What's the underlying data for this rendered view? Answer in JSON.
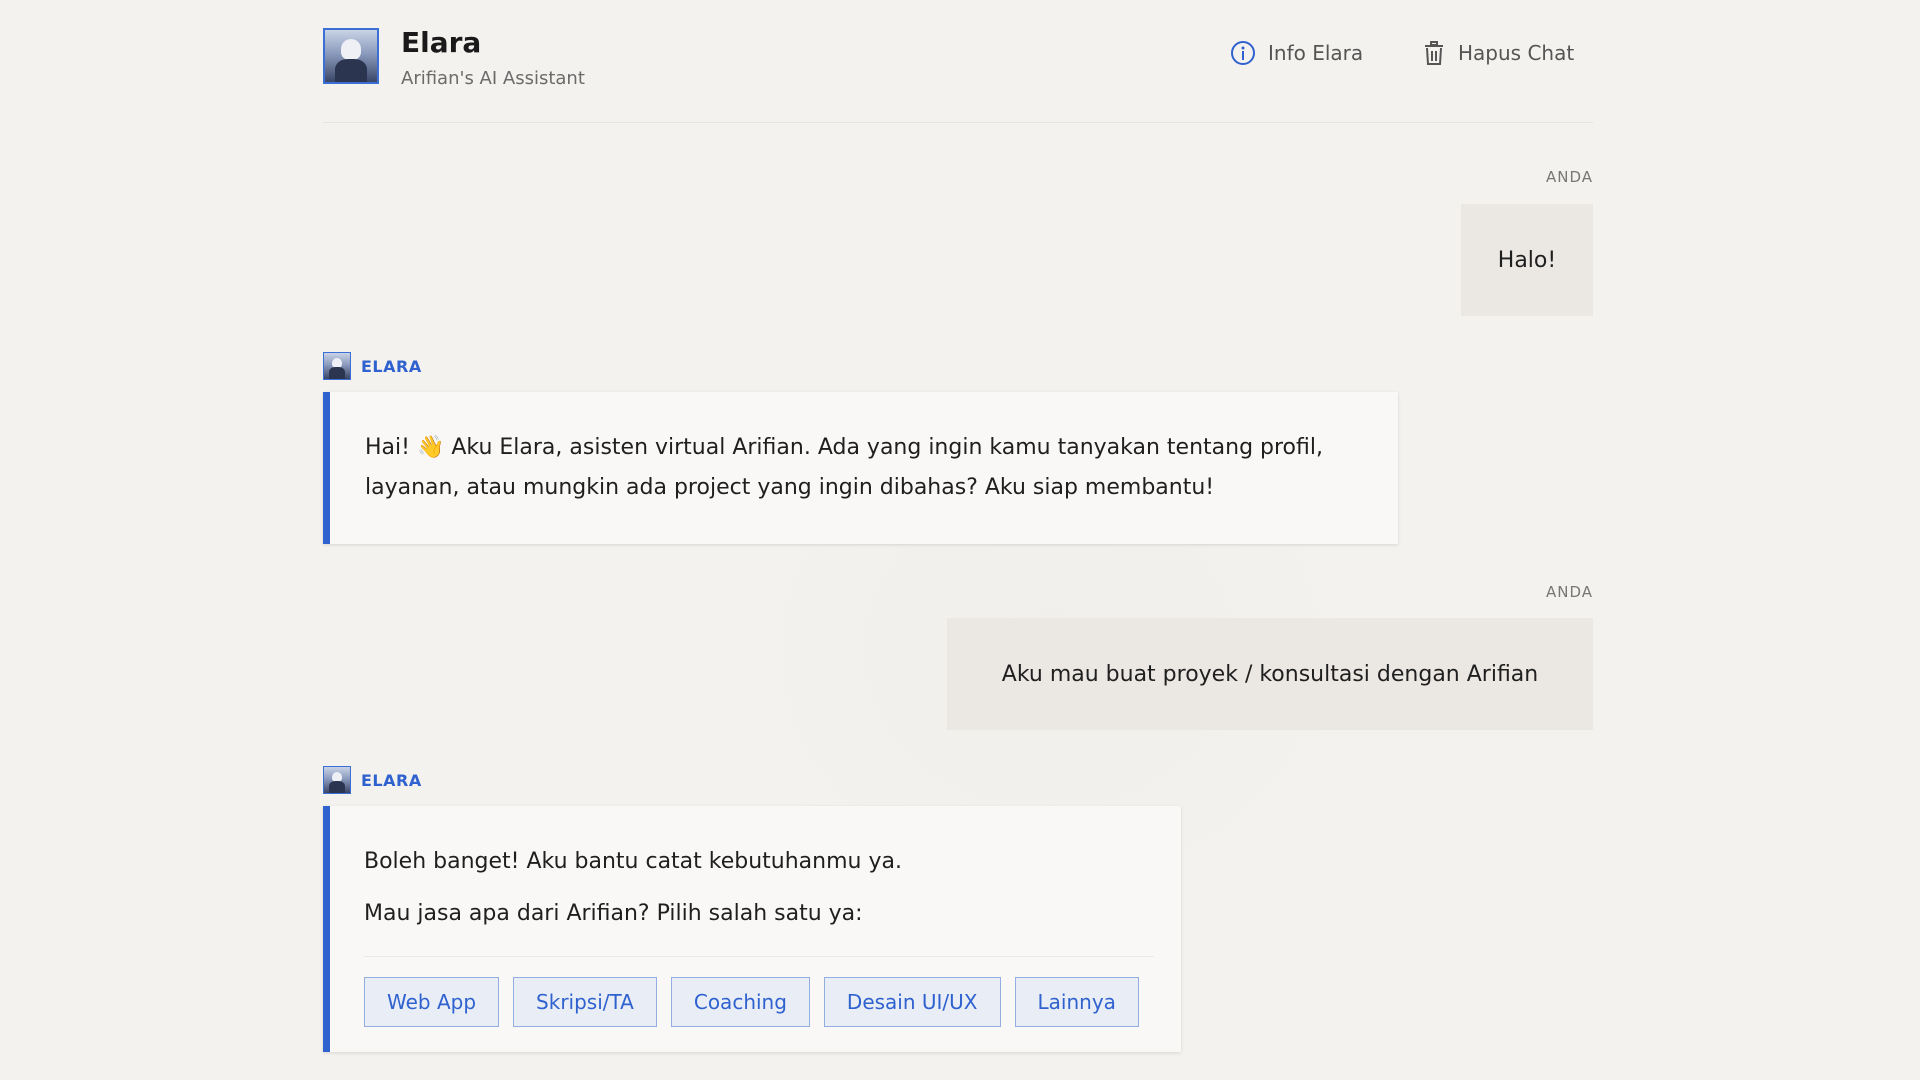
{
  "header": {
    "title": "Elara",
    "subtitle": "Arifian's AI Assistant",
    "actions": {
      "info_label": "Info Elara",
      "delete_label": "Hapus Chat"
    }
  },
  "messages": [
    {
      "sender": "ANDA",
      "text": "Halo!"
    },
    {
      "sender": "ELARA",
      "text": "Hai! 👋 Aku Elara, asisten virtual Arifian. Ada yang ingin kamu tanyakan tentang profil, layanan, atau mungkin ada project yang ingin dibahas? Aku siap membantu!"
    },
    {
      "sender": "ANDA",
      "text": "Aku mau buat proyek / konsultasi dengan Arifian"
    },
    {
      "sender": "ELARA",
      "lines": [
        "Boleh banget! Aku bantu catat kebutuhanmu ya.",
        "Mau jasa apa dari Arifian? Pilih salah satu ya:"
      ],
      "choices": [
        "Web App",
        "Skripsi/TA",
        "Coaching",
        "Desain UI/UX",
        "Lainnya"
      ]
    }
  ],
  "colors": {
    "accent": "#2f62cf",
    "background": "#f4f2ee",
    "user_bubble": "#ebe8e3",
    "assistant_bubble": "#faf8f6"
  },
  "icons": {
    "info": "info-circle-icon",
    "delete": "trash-icon"
  }
}
